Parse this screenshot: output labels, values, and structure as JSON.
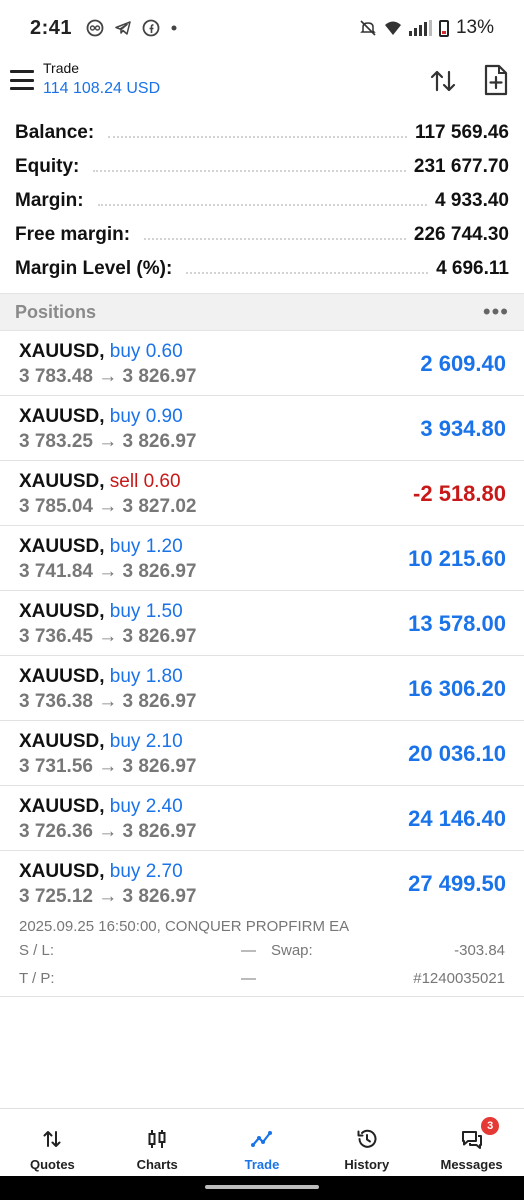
{
  "status_bar": {
    "time": "2:41",
    "left_icons": [
      "sync-icon",
      "telegram-icon",
      "facebook-icon",
      "dot-icon"
    ],
    "battery_text": "13%"
  },
  "header": {
    "title": "Trade",
    "balance": "114 108.24 USD"
  },
  "summary": [
    {
      "label": "Balance:",
      "value": "117 569.46"
    },
    {
      "label": "Equity:",
      "value": "231 677.70"
    },
    {
      "label": "Margin:",
      "value": "4 933.40"
    },
    {
      "label": "Free margin:",
      "value": "226 744.30"
    },
    {
      "label": "Margin Level (%):",
      "value": "4 696.11"
    }
  ],
  "positions": {
    "title": "Positions",
    "more": "•••",
    "items": [
      {
        "symbol": "XAUUSD,",
        "type": "buy 0.60",
        "prices": "3 783.48 → 3 826.97",
        "profit": "2 609.40"
      },
      {
        "symbol": "XAUUSD,",
        "type": "buy 0.90",
        "prices": "3 783.25 → 3 826.97",
        "profit": "3 934.80"
      },
      {
        "symbol": "XAUUSD,",
        "type": "sell 0.60",
        "prices": "3 785.04 → 3 827.02",
        "profit": "-2 518.80"
      },
      {
        "symbol": "XAUUSD,",
        "type": "buy 1.20",
        "prices": "3 741.84 → 3 826.97",
        "profit": "10 215.60"
      },
      {
        "symbol": "XAUUSD,",
        "type": "buy 1.50",
        "prices": "3 736.45 → 3 826.97",
        "profit": "13 578.00"
      },
      {
        "symbol": "XAUUSD,",
        "type": "buy 1.80",
        "prices": "3 736.38 → 3 826.97",
        "profit": "16 306.20"
      },
      {
        "symbol": "XAUUSD,",
        "type": "buy 2.10",
        "prices": "3 731.56 → 3 826.97",
        "profit": "20 036.10"
      },
      {
        "symbol": "XAUUSD,",
        "type": "buy 2.40",
        "prices": "3 726.36 → 3 826.97",
        "profit": "24 146.40"
      }
    ],
    "expanded": {
      "symbol": "XAUUSD,",
      "type": "buy 2.70",
      "prices": "3 725.12 → 3 826.97",
      "profit": "27 499.50",
      "comment": "2025.09.25 16:50:00, CONQUER PROPFIRM EA",
      "sl_label": "S / L:",
      "sl_value": "—",
      "swap_label": "Swap:",
      "swap_value": "-303.84",
      "tp_label": "T / P:",
      "tp_value": "—",
      "ticket": "#1240035021"
    }
  },
  "nav": {
    "quotes": "Quotes",
    "charts": "Charts",
    "trade": "Trade",
    "history": "History",
    "messages": "Messages",
    "messages_badge": "3",
    "active": "Trade"
  },
  "colors": {
    "accent_blue": "#1a73e8",
    "loss_red": "#c81818",
    "badge_red": "#e53935"
  }
}
